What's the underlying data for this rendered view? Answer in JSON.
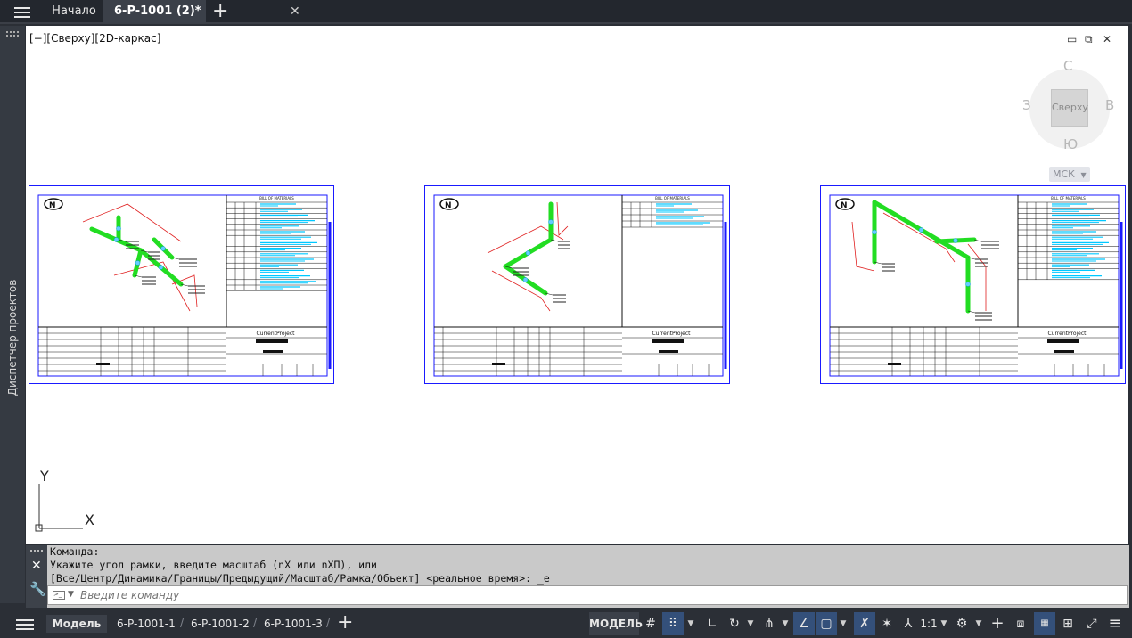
{
  "topbar": {
    "tabs": [
      {
        "label": "Начало"
      },
      {
        "label": "6-P-1001 (2)*"
      }
    ],
    "close_glyph": "✕",
    "add_glyph": "+"
  },
  "left_palette": {
    "label": "Диспетчер проектов"
  },
  "viewport": {
    "label": "[−][Сверху][2D-каркас]",
    "viewcube": {
      "north": "С",
      "south": "Ю",
      "west": "З",
      "east": "В",
      "face": "Сверху",
      "ucs": "МСК"
    }
  },
  "sheets": [
    {
      "project": "CurrentProject",
      "table_header": "BILL OF MATERIALS",
      "variant": "a"
    },
    {
      "project": "CurrentProject",
      "table_header": "BILL OF MATERIALS",
      "variant": "b"
    },
    {
      "project": "CurrentProject",
      "table_header": "BILL OF MATERIALS",
      "variant": "c"
    }
  ],
  "ucs": {
    "x": "X",
    "y": "Y"
  },
  "command": {
    "history": [
      "Команда:",
      "Укажите угол рамки, введите масштаб (nX или nXП), или",
      "[Все/Центр/Динамика/Границы/Предыдущий/Масштаб/Рамка/Объект] <реальное время>: _e"
    ],
    "placeholder": "Введите команду",
    "close_glyph": "✕",
    "settings_glyph": "🔧"
  },
  "status": {
    "layout_tabs": [
      "Модель",
      "6-P-1001-1",
      "6-P-1001-2",
      "6-P-1001-3"
    ],
    "model_button": "МОДЕЛЬ",
    "scale": "1:1",
    "add_glyph": "+",
    "toggles": {
      "grid": true,
      "snap": true,
      "ortho": false,
      "polar": false,
      "osnap": false,
      "lineweight": true,
      "transparency": true,
      "annotation_visibility": true
    }
  },
  "colors": {
    "accent_on": "#34507a",
    "sheet_border": "#1a1aff",
    "pipe_green": "#22dd22",
    "dim_red": "#e02020",
    "cyan_text": "#00c8ff"
  }
}
